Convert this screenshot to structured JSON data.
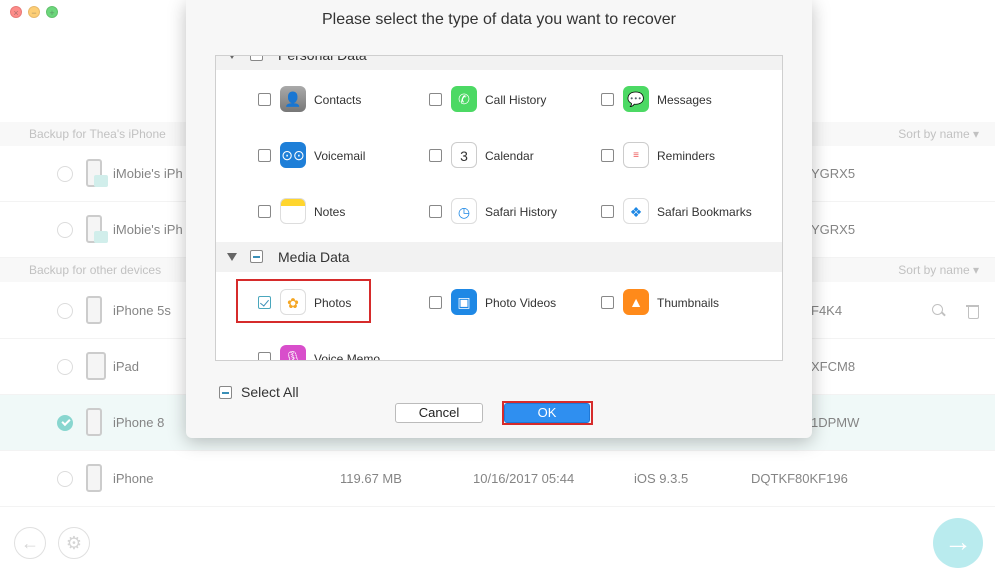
{
  "sections": [
    {
      "title": "Backup for Thea's iPhone",
      "sort": "Sort by name ▾"
    },
    {
      "title": "Backup for other devices",
      "sort": "Sort by name ▾"
    }
  ],
  "rows": [
    {
      "name": "iMobie's iPh",
      "tail": "YGRX5",
      "size": "",
      "date": "",
      "ios": "",
      "serial": ""
    },
    {
      "name": "iMobie's iPh",
      "tail": "YGRX5",
      "size": "",
      "date": "",
      "ios": "",
      "serial": ""
    },
    {
      "name": "iPhone 5s",
      "tail": "F4K4",
      "size": "",
      "date": "",
      "ios": "",
      "serial": ""
    },
    {
      "name": "iPad",
      "tail": "XFCM8",
      "size": "",
      "date": "",
      "ios": "",
      "serial": ""
    },
    {
      "name": "iPhone 8",
      "tail": "1DPMW",
      "size": "",
      "date": "",
      "ios": "",
      "serial": ""
    },
    {
      "name": "iPhone",
      "tail": "",
      "size": "119.67 MB",
      "date": "10/16/2017 05:44",
      "ios": "iOS 9.3.5",
      "serial": "DQTKF80KF196"
    }
  ],
  "dialog": {
    "title": "Please select the type of data you want to recover",
    "groups": [
      {
        "title": "Personal Data"
      },
      {
        "title": "Media Data"
      }
    ],
    "items": {
      "contacts": "Contacts",
      "call_history": "Call History",
      "messages": "Messages",
      "voicemail": "Voicemail",
      "calendar": "Calendar",
      "calendar_day": "3",
      "reminders": "Reminders",
      "notes": "Notes",
      "safari_history": "Safari History",
      "safari_bookmarks": "Safari Bookmarks",
      "photos": "Photos",
      "photo_videos": "Photo Videos",
      "thumbnails": "Thumbnails",
      "voice_memo": "Voice Memo"
    },
    "select_all": "Select All",
    "cancel": "Cancel",
    "ok": "OK"
  },
  "colors": {
    "accent": "#2f8ff0",
    "highlight": "#d62b2b",
    "teal": "#5ac7bd"
  },
  "icons": {
    "back": "←",
    "settings": "⚙",
    "next": "→",
    "close": "×",
    "minimize": "−",
    "maximize": "+"
  }
}
